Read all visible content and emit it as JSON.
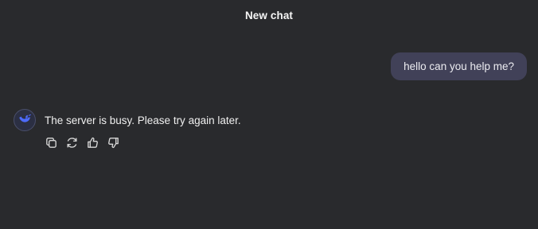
{
  "header": {
    "title": "New chat"
  },
  "conversation": {
    "user_message": "hello can you help me?",
    "assistant_message": "The server is busy. Please try again later."
  },
  "assistant": {
    "avatar_icon": "whale-logo-icon",
    "accent_color": "#4d6bfe"
  },
  "message_actions": [
    {
      "icon": "copy-icon"
    },
    {
      "icon": "regenerate-icon"
    },
    {
      "icon": "thumbs-up-icon"
    },
    {
      "icon": "thumbs-down-icon"
    }
  ],
  "colors": {
    "background": "#292a2d",
    "user_bubble": "#414158",
    "text": "#f0f0f0"
  }
}
